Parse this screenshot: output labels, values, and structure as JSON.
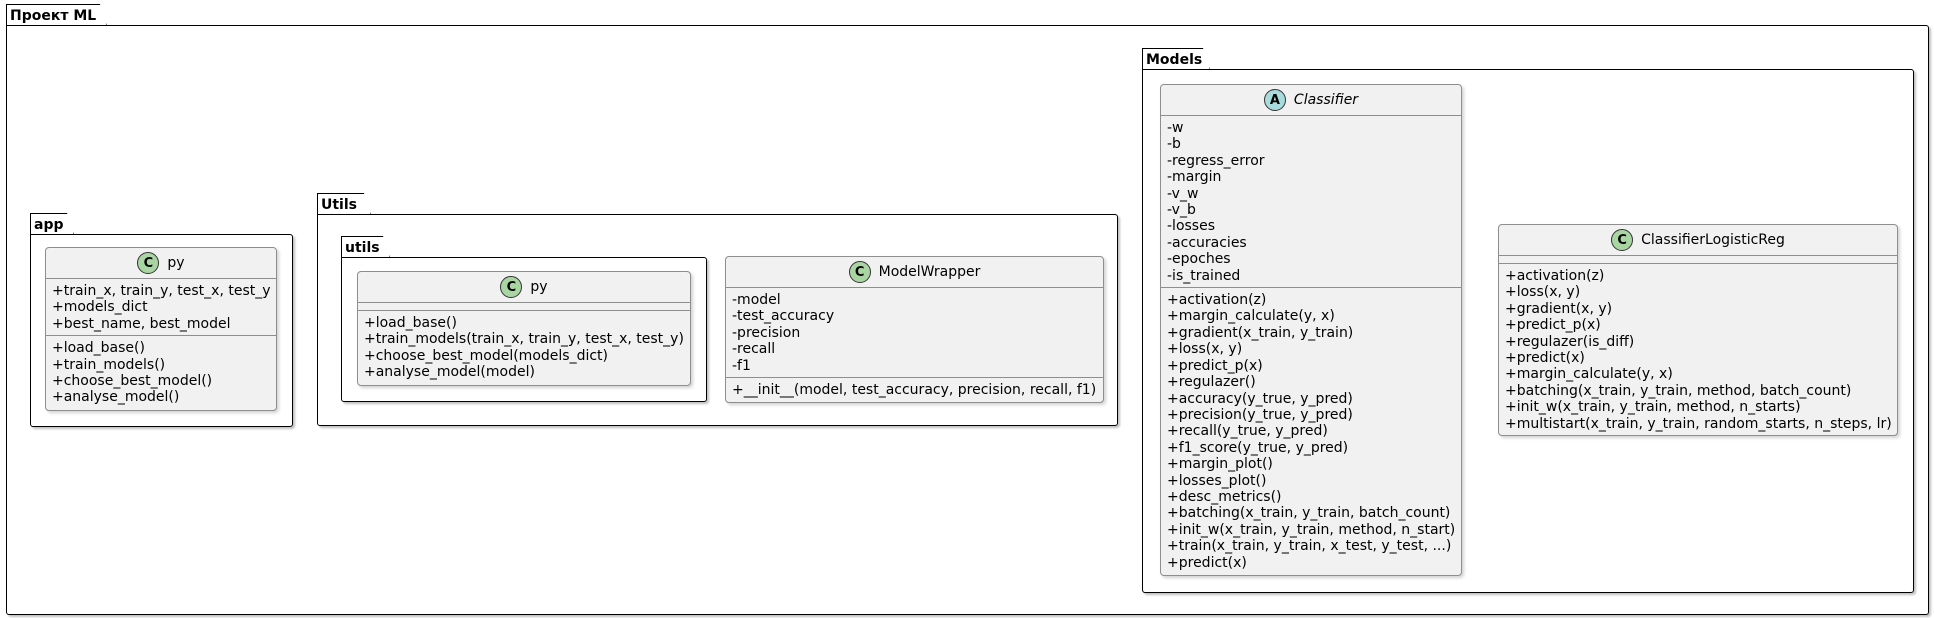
{
  "packages": {
    "project": {
      "name": "Проект ML"
    },
    "app": {
      "name": "app"
    },
    "utils_pkg": {
      "name": "Utils"
    },
    "utils_sub": {
      "name": "utils"
    },
    "models": {
      "name": "Models"
    }
  },
  "classes": {
    "app_py": {
      "stereotype": "C",
      "name": "py",
      "fields": [
        "+train_x, train_y, test_x, test_y",
        "+models_dict",
        "+best_name, best_model"
      ],
      "methods": [
        "+load_base()",
        "+train_models()",
        "+choose_best_model()",
        "+analyse_model()"
      ]
    },
    "utils_py": {
      "stereotype": "C",
      "name": "py",
      "fields": [],
      "methods": [
        "+load_base()",
        "+train_models(train_x, train_y, test_x, test_y)",
        "+choose_best_model(models_dict)",
        "+analyse_model(model)"
      ]
    },
    "model_wrapper": {
      "stereotype": "C",
      "name": "ModelWrapper",
      "fields": [
        "-model",
        "-test_accuracy",
        "-precision",
        "-recall",
        "-f1"
      ],
      "methods": [
        "+__init__(model, test_accuracy, precision, recall, f1)"
      ]
    },
    "classifier": {
      "stereotype": "A",
      "name": "Classifier",
      "fields": [
        "-w",
        "-b",
        "-regress_error",
        "-margin",
        "-v_w",
        "-v_b",
        "-losses",
        "-accuracies",
        "-epoches",
        "-is_trained"
      ],
      "methods": [
        "+activation(z)",
        "+margin_calculate(y, x)",
        "+gradient(x_train, y_train)",
        "+loss(x, y)",
        "+predict_p(x)",
        "+regulazer()",
        "+accuracy(y_true, y_pred)",
        "+precision(y_true, y_pred)",
        "+recall(y_true, y_pred)",
        "+f1_score(y_true, y_pred)",
        "+margin_plot()",
        "+losses_plot()",
        "+desc_metrics()",
        "+batching(x_train, y_train, batch_count)",
        "+init_w(x_train, y_train, method, n_start)",
        "+train(x_train, y_train, x_test, y_test, ...)",
        "+predict(x)"
      ]
    },
    "classifier_logreg": {
      "stereotype": "C",
      "name": "ClassifierLogisticReg",
      "fields": [],
      "methods": [
        "+activation(z)",
        "+loss(x, y)",
        "+gradient(x, y)",
        "+predict_p(x)",
        "+regulazer(is_diff)",
        "+predict(x)",
        "+margin_calculate(y, x)",
        "+batching(x_train, y_train, method, batch_count)",
        "+init_w(x_train, y_train, method, n_starts)",
        "+multistart(x_train, y_train, random_starts, n_steps, lr)"
      ]
    }
  }
}
